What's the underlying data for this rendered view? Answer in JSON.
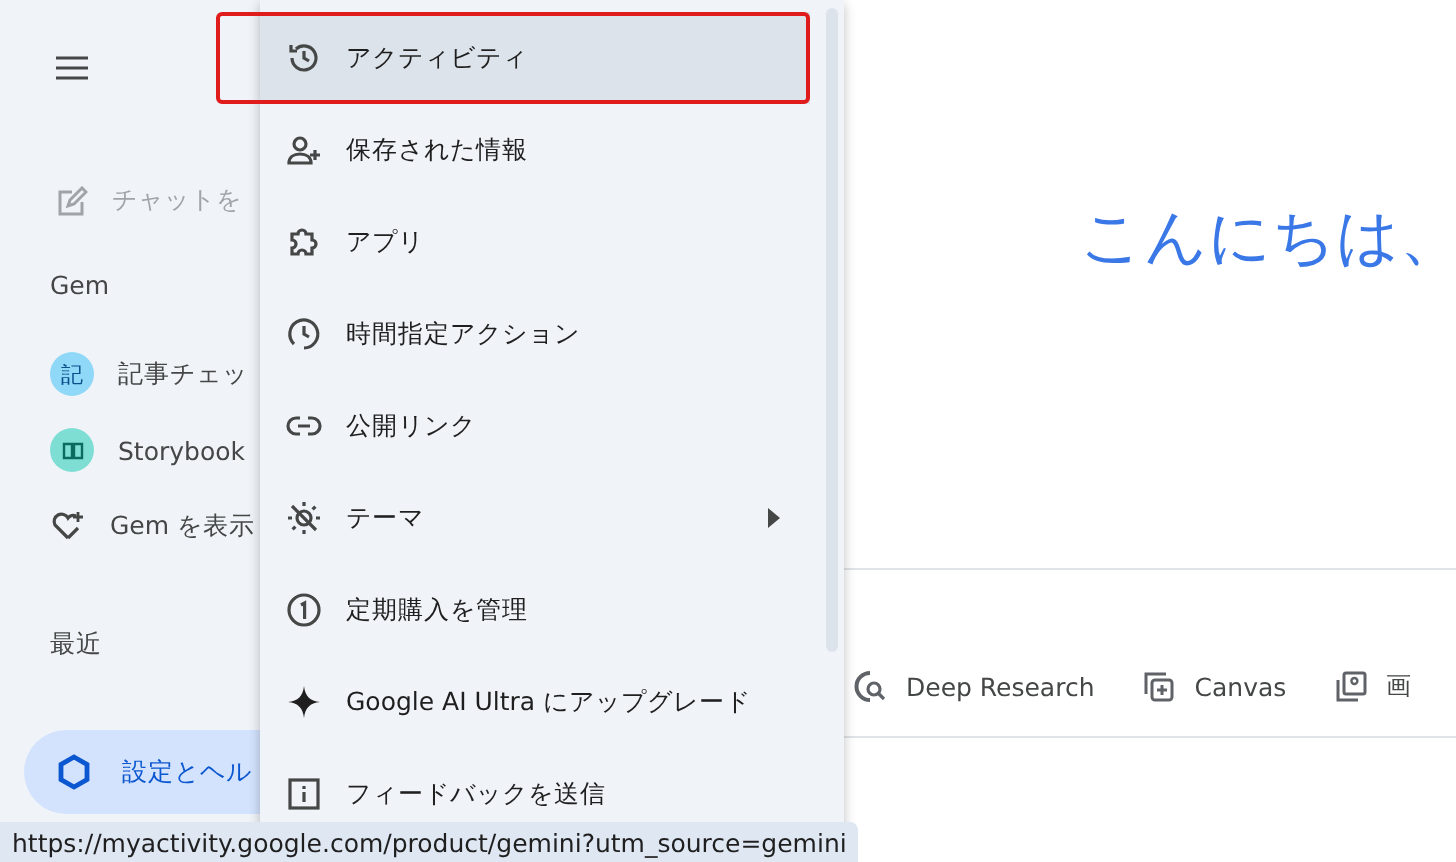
{
  "sidebar": {
    "new_chat": "チャットを",
    "gem_heading": "Gem",
    "gems": [
      {
        "kind": "letter",
        "avatar": "記",
        "label": "記事チェッ",
        "color": "#8fd8f8"
      },
      {
        "kind": "book",
        "label": "Storybook",
        "color": "#7fded4"
      }
    ],
    "show_gems": "Gem を表示",
    "recent_heading": "最近",
    "settings": {
      "label": "設定とヘル",
      "selected": true
    }
  },
  "menu": {
    "items": [
      {
        "kind": "history",
        "label": "アクティビティ",
        "selected": true,
        "highlighted": true
      },
      {
        "kind": "person-add",
        "label": "保存された情報",
        "selected": false,
        "highlighted": false
      },
      {
        "kind": "puzzle",
        "label": "アプリ",
        "selected": false,
        "highlighted": false
      },
      {
        "kind": "clock",
        "label": "時間指定アクション",
        "selected": false,
        "highlighted": false
      },
      {
        "kind": "link",
        "label": "公開リンク",
        "selected": false,
        "highlighted": false
      },
      {
        "kind": "theme",
        "label": "テーマ",
        "selected": false,
        "highlighted": false,
        "submenu": true
      },
      {
        "kind": "one",
        "label": "定期購入を管理",
        "selected": false,
        "highlighted": false
      },
      {
        "kind": "spark",
        "label": "Google AI Ultra にアップグレード",
        "selected": false,
        "highlighted": false
      },
      {
        "kind": "info",
        "label": "フィードバックを送信",
        "selected": false,
        "highlighted": false
      }
    ]
  },
  "main": {
    "greeting": "こんにちは、",
    "tools": [
      {
        "kind": "research",
        "label": "Deep Research"
      },
      {
        "kind": "canvas",
        "label": "Canvas"
      },
      {
        "kind": "image",
        "label": "画"
      }
    ]
  },
  "status_url": "https://myactivity.google.com/product/gemini?utm_source=gemini"
}
